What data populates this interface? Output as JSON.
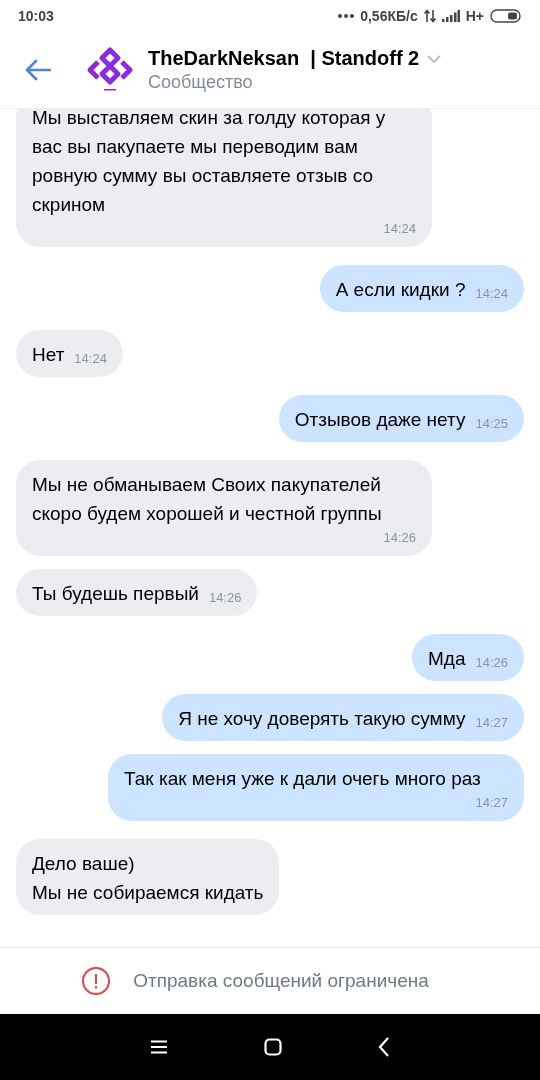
{
  "status_bar": {
    "time": "10:03",
    "speed": "0,56КБ/с",
    "network": "H+"
  },
  "header": {
    "title": "TheDarkNeksan  | Standoff 2",
    "subtitle": "Сообщество"
  },
  "messages": [
    {
      "outgoing": false,
      "text": "Мы выставляем скин за голду которая у вас вы пакупаете мы переводим вам ровную сумму вы оставляете отзыв со скрином",
      "time": "14:24"
    },
    {
      "outgoing": true,
      "text": "А если кидки ?",
      "time": "14:24"
    },
    {
      "outgoing": false,
      "text": "Нет",
      "time": "14:24"
    },
    {
      "outgoing": true,
      "text": "Отзывов даже нету",
      "time": "14:25"
    },
    {
      "outgoing": false,
      "text": "Мы не обманываем Своих пакупателей скоро будем хорошей и честной группы",
      "time": "14:26"
    },
    {
      "outgoing": false,
      "text": "Ты будешь первый",
      "time": "14:26"
    },
    {
      "outgoing": true,
      "text": "Мда",
      "time": "14:26"
    },
    {
      "outgoing": true,
      "text": "Я не хочу доверять такую сумму",
      "time": "14:27"
    },
    {
      "outgoing": true,
      "text": "Так как меня уже к дали очегь много раз",
      "time": "14:27"
    },
    {
      "outgoing": false,
      "text": "Дело ваше)\nМы не собираемся кидать"
    }
  ],
  "footer": {
    "notice": "Отправка сообщений ограничена"
  }
}
